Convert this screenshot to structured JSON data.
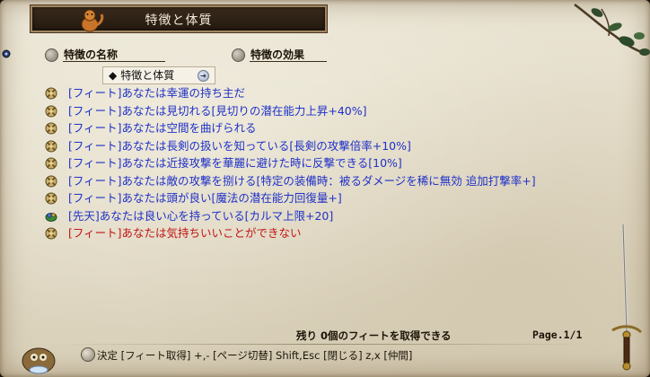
{
  "window": {
    "title": "特徴と体質"
  },
  "columns": {
    "name": "特徴の名称",
    "effect": "特徴の効果"
  },
  "filter": {
    "label": "特徴と体質"
  },
  "traits": [
    {
      "text": "[フィート]あなたは幸運の持ち主だ",
      "color": "#1f31c8",
      "icon": "feat-icon"
    },
    {
      "text": "[フィート]あなたは見切れる[見切りの潜在能力上昇+40%]",
      "color": "#1f31c8",
      "icon": "feat-icon"
    },
    {
      "text": "[フィート]あなたは空間を曲げられる",
      "color": "#1f31c8",
      "icon": "feat-icon"
    },
    {
      "text": "[フィート]あなたは長剣の扱いを知っている[長剣の攻撃倍率+10%]",
      "color": "#1f31c8",
      "icon": "feat-icon"
    },
    {
      "text": "[フィート]あなたは近接攻撃を華麗に避けた時に反撃できる[10%]",
      "color": "#1f31c8",
      "icon": "feat-icon"
    },
    {
      "text": "[フィート]あなたは敵の攻撃を捌ける[特定の装備時：被るダメージを稀に無効 追加打撃率+]",
      "color": "#1f31c8",
      "icon": "feat-icon"
    },
    {
      "text": "[フィート]あなたは頭が良い[魔法の潜在能力回復量+]",
      "color": "#1f31c8",
      "icon": "feat-icon"
    },
    {
      "text": "[先天]あなたは良い心を持っている[カルマ上限+20]",
      "color": "#1f31c8",
      "icon": "innate-icon"
    },
    {
      "text": "[フィート]あなたは気持ちいいことができない",
      "color": "#c01515",
      "icon": "feat-icon"
    }
  ],
  "footer": {
    "remaining": "残り 0個のフィートを取得できる",
    "page": "Page.1/1",
    "hint": "決定 [フィート取得]  +,- [ページ切替]  Shift,Esc [閉じる]  z,x [仲間]"
  }
}
